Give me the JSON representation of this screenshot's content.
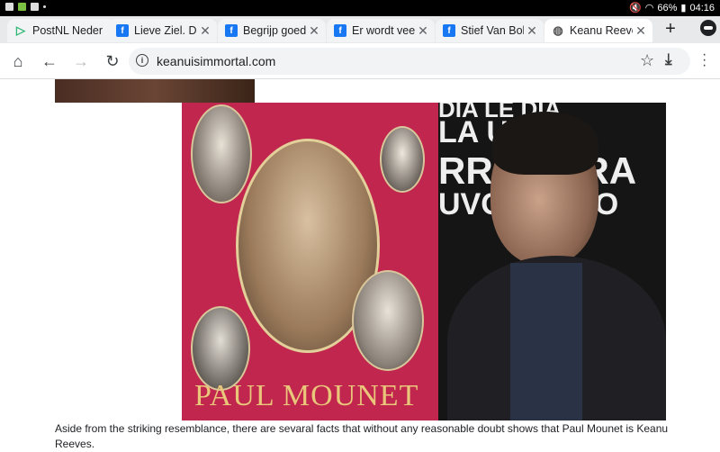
{
  "status_bar": {
    "battery": "66%",
    "time": "04:16"
  },
  "tabs": [
    {
      "favicon": "postnl-icon",
      "title": "PostNL Neder"
    },
    {
      "favicon": "facebook-icon",
      "title": "Lieve Ziel. De"
    },
    {
      "favicon": "facebook-icon",
      "title": "Begrijp goed w"
    },
    {
      "favicon": "facebook-icon",
      "title": "Er wordt veel"
    },
    {
      "favicon": "facebook-icon",
      "title": "Stief Van Bokh"
    },
    {
      "favicon": "globe-icon",
      "title": "Keanu Reeves",
      "active": true
    }
  ],
  "toolbar": {
    "url": "keanuisimmortal.com"
  },
  "article": {
    "poster_title": "PAUL MOUNET",
    "bg_line1": "DIA   LE DIA",
    "bg_line2": "LA   UE LA",
    "bg_line3": "RRA   ERRA",
    "bg_line4": "UVO   ETUVO",
    "caption": "Aside from the striking resemblance, there are sevaral facts that without any reasonable doubt shows that Paul Mounet is Keanu Reeves."
  },
  "colors": {
    "poster_bg": "#c1264e",
    "poster_title": "#e9c67a",
    "facebook": "#1877f2",
    "postnl": "#2bb673"
  }
}
